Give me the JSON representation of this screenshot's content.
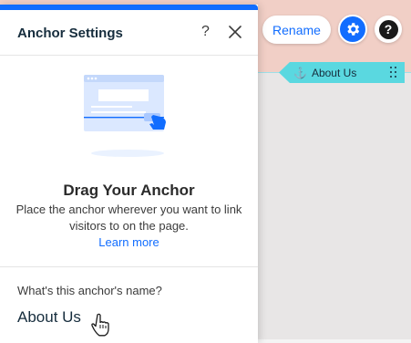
{
  "canvas": {
    "rename_label": "Rename",
    "anchor_tag_label": "About Us",
    "icons": {
      "anchor": "anchor-icon",
      "settings": "gear-icon",
      "help": "question-icon",
      "drag": "drag-handle-icon"
    }
  },
  "panel": {
    "title": "Anchor Settings",
    "help_glyph": "?",
    "close_icon": "close-icon",
    "illustration": "drag-anchor-illustration",
    "heading": "Drag Your Anchor",
    "description": "Place the anchor wherever you want to link visitors to on the page.",
    "learn_more_label": "Learn more",
    "name_field": {
      "label": "What's this anchor's name?",
      "value": "About Us"
    }
  },
  "colors": {
    "accent": "#116dff",
    "anchor_tag": "#5ad8e0",
    "header_background": "#f1cfc6",
    "canvas_background": "#e8e6e6"
  }
}
